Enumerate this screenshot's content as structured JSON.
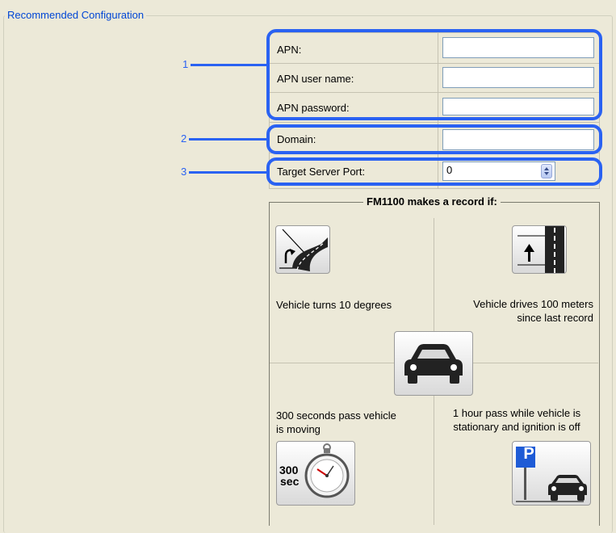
{
  "group": {
    "title": "Recommended Configuration"
  },
  "config": {
    "apn_label": "APN:",
    "apn_user_label": "APN user name:",
    "apn_password_label": "APN password:",
    "domain_label": "Domain:",
    "port_label": "Target Server Port:",
    "apn_value": "",
    "apn_user_value": "",
    "apn_password_value": "",
    "domain_value": "",
    "port_value": "0"
  },
  "callouts": [
    "1",
    "2",
    "3"
  ],
  "record": {
    "title": "FM1100 makes a record if:",
    "turn_text": "Vehicle turns 10 degrees",
    "distance_text_1": "Vehicle drives 100 meters",
    "distance_text_2": "since last record",
    "time_text_1": "300 seconds pass vehicle",
    "time_text_2": "is moving",
    "stationary_text_1": "1 hour pass while vehicle is",
    "stationary_text_2": "stationary and ignition is off",
    "stopwatch_label_1": "300",
    "stopwatch_label_2": "sec",
    "parking_letter": "P"
  },
  "colors": {
    "accent": "#2a62f2",
    "legend": "#0046d5",
    "panel": "#ece9d8"
  },
  "icons": [
    "road-turn-icon",
    "lane-distance-icon",
    "car-icon",
    "stopwatch-icon",
    "parking-icon",
    "spin-up-icon",
    "spin-down-icon"
  ]
}
